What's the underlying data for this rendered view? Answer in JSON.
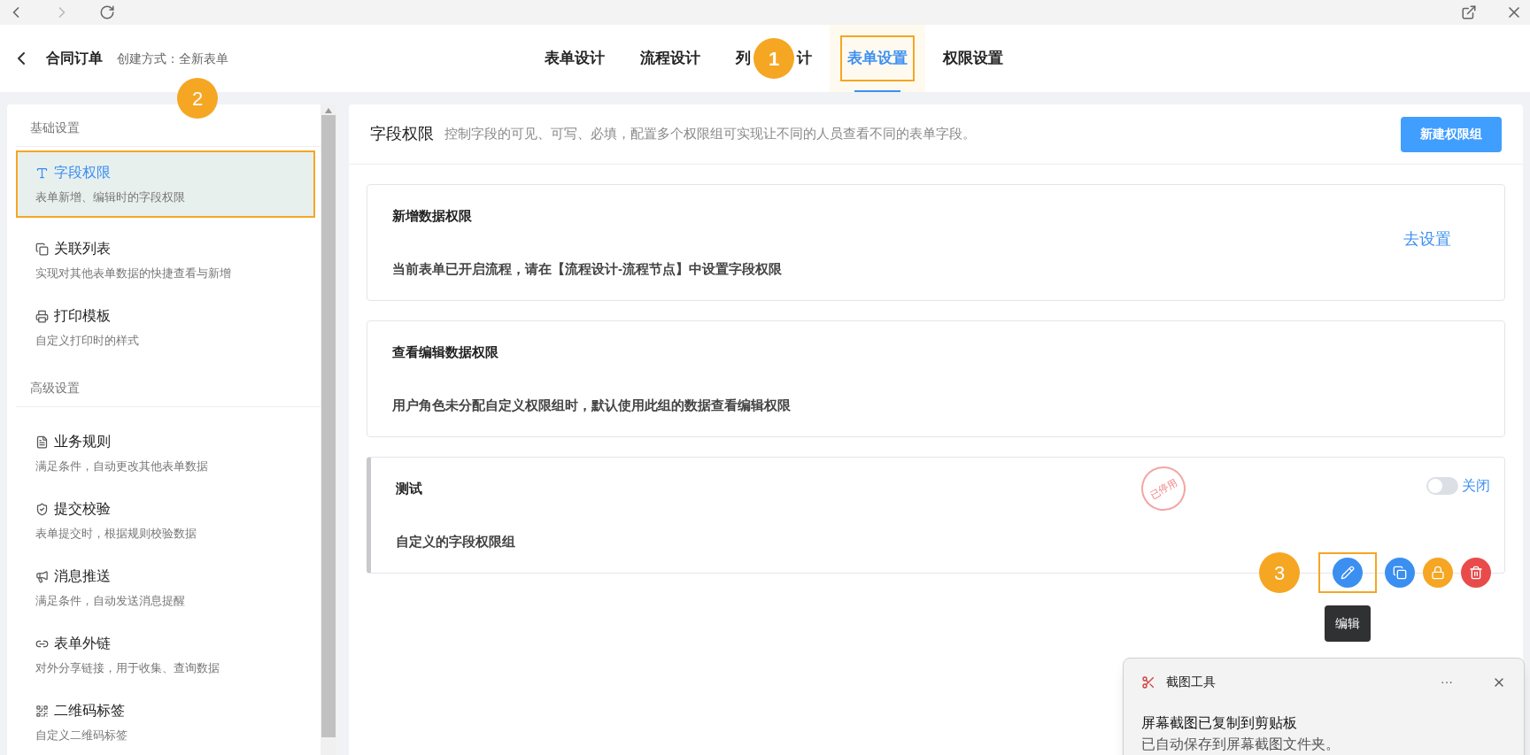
{
  "header": {
    "title": "合同订单",
    "creation": "创建方式：全新表单"
  },
  "tabs": [
    {
      "label": "表单设计",
      "selected": false
    },
    {
      "label": "流程设计",
      "selected": false
    },
    {
      "label_start": "列",
      "label_end": "计",
      "selected": false,
      "kind": "covered"
    },
    {
      "label": "表单设置",
      "selected": true
    },
    {
      "label": "权限设置",
      "selected": false
    }
  ],
  "badges": [
    "1",
    "2",
    "3"
  ],
  "sidebar": {
    "sections": [
      {
        "heading": "基础设置",
        "items": [
          {
            "title": "字段权限",
            "desc": "表单新增、编辑时的字段权限",
            "selected": true
          },
          {
            "title": "关联列表",
            "desc": "实现对其他表单数据的快捷查看与新增",
            "selected": false
          },
          {
            "title": "打印模板",
            "desc": "自定义打印时的样式",
            "selected": false
          }
        ]
      },
      {
        "heading": "高级设置",
        "items": [
          {
            "title": "业务规则",
            "desc": "满足条件，自动更改其他表单数据",
            "selected": false
          },
          {
            "title": "提交校验",
            "desc": "表单提交时，根据规则校验数据",
            "selected": false
          },
          {
            "title": "消息推送",
            "desc": "满足条件，自动发送消息提醒",
            "selected": false
          },
          {
            "title": "表单外链",
            "desc": "对外分享链接，用于收集、查询数据",
            "selected": false
          },
          {
            "title": "二维码标签",
            "desc": "自定义二维码标签",
            "selected": false
          }
        ]
      }
    ]
  },
  "main": {
    "title": "字段权限",
    "description": "控制字段的可见、可写、必填，配置多个权限组可实现让不同的人员查看不同的表单字段。",
    "new_button": "新建权限组",
    "groups": [
      {
        "kind": "link",
        "title": "新增数据权限",
        "desc": "当前表单已开启流程，请在【流程设计-流程节点】中设置字段权限",
        "link": "去设置"
      },
      {
        "kind": "plain",
        "title": "查看编辑数据权限",
        "desc": "用户角色未分配自定义权限组时，默认使用此组的数据查看编辑权限"
      },
      {
        "kind": "custom",
        "title": "测试",
        "desc": "自定义的字段权限组",
        "stamp": "已停用",
        "toggle": {
          "on": false,
          "label": "关闭"
        },
        "tooltip": "编辑"
      }
    ]
  },
  "notification": {
    "app": "截图工具",
    "more": "···",
    "message": "屏幕截图已复制到剪贴板",
    "detail": "已自动保存到屏幕截图文件夹。"
  }
}
